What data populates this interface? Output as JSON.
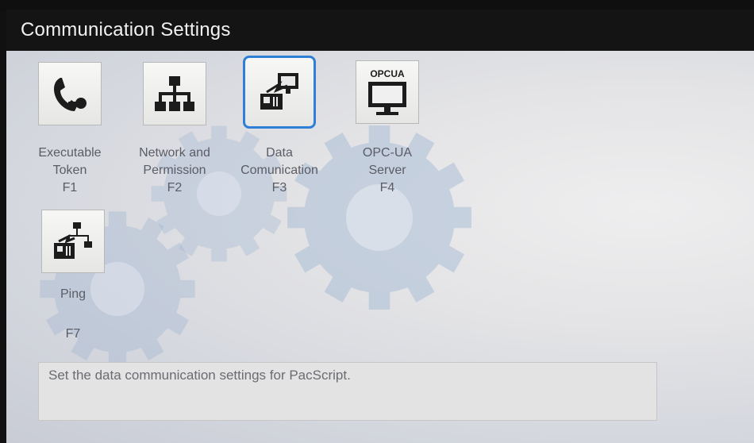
{
  "window": {
    "title": "Communication Settings"
  },
  "items": [
    {
      "id": "executable-token",
      "line1": "Executable",
      "line2": "Token",
      "key": "F1",
      "icon": "phone-key-icon",
      "selected": false
    },
    {
      "id": "network-permission",
      "line1": "Network and",
      "line2": "Permission",
      "key": "F2",
      "icon": "network-tree-icon",
      "selected": false
    },
    {
      "id": "data-communication",
      "line1": "Data",
      "line2": "Comunication",
      "key": "F3",
      "icon": "data-communication-icon",
      "selected": true
    },
    {
      "id": "opcua-server",
      "line1": "OPC-UA",
      "line2": "Server",
      "key": "F4",
      "icon": "opcua-monitor-icon",
      "icon_text": "OPCUA",
      "selected": false
    },
    {
      "id": "ping",
      "line1": "Ping",
      "line2": "",
      "key": "F7",
      "icon": "ping-network-icon",
      "selected": false
    }
  ],
  "description": "Set the data communication settings for PacScript.",
  "colors": {
    "selection": "#2f7fd6",
    "titlebar": "#141414",
    "label": "#5a5d66"
  }
}
